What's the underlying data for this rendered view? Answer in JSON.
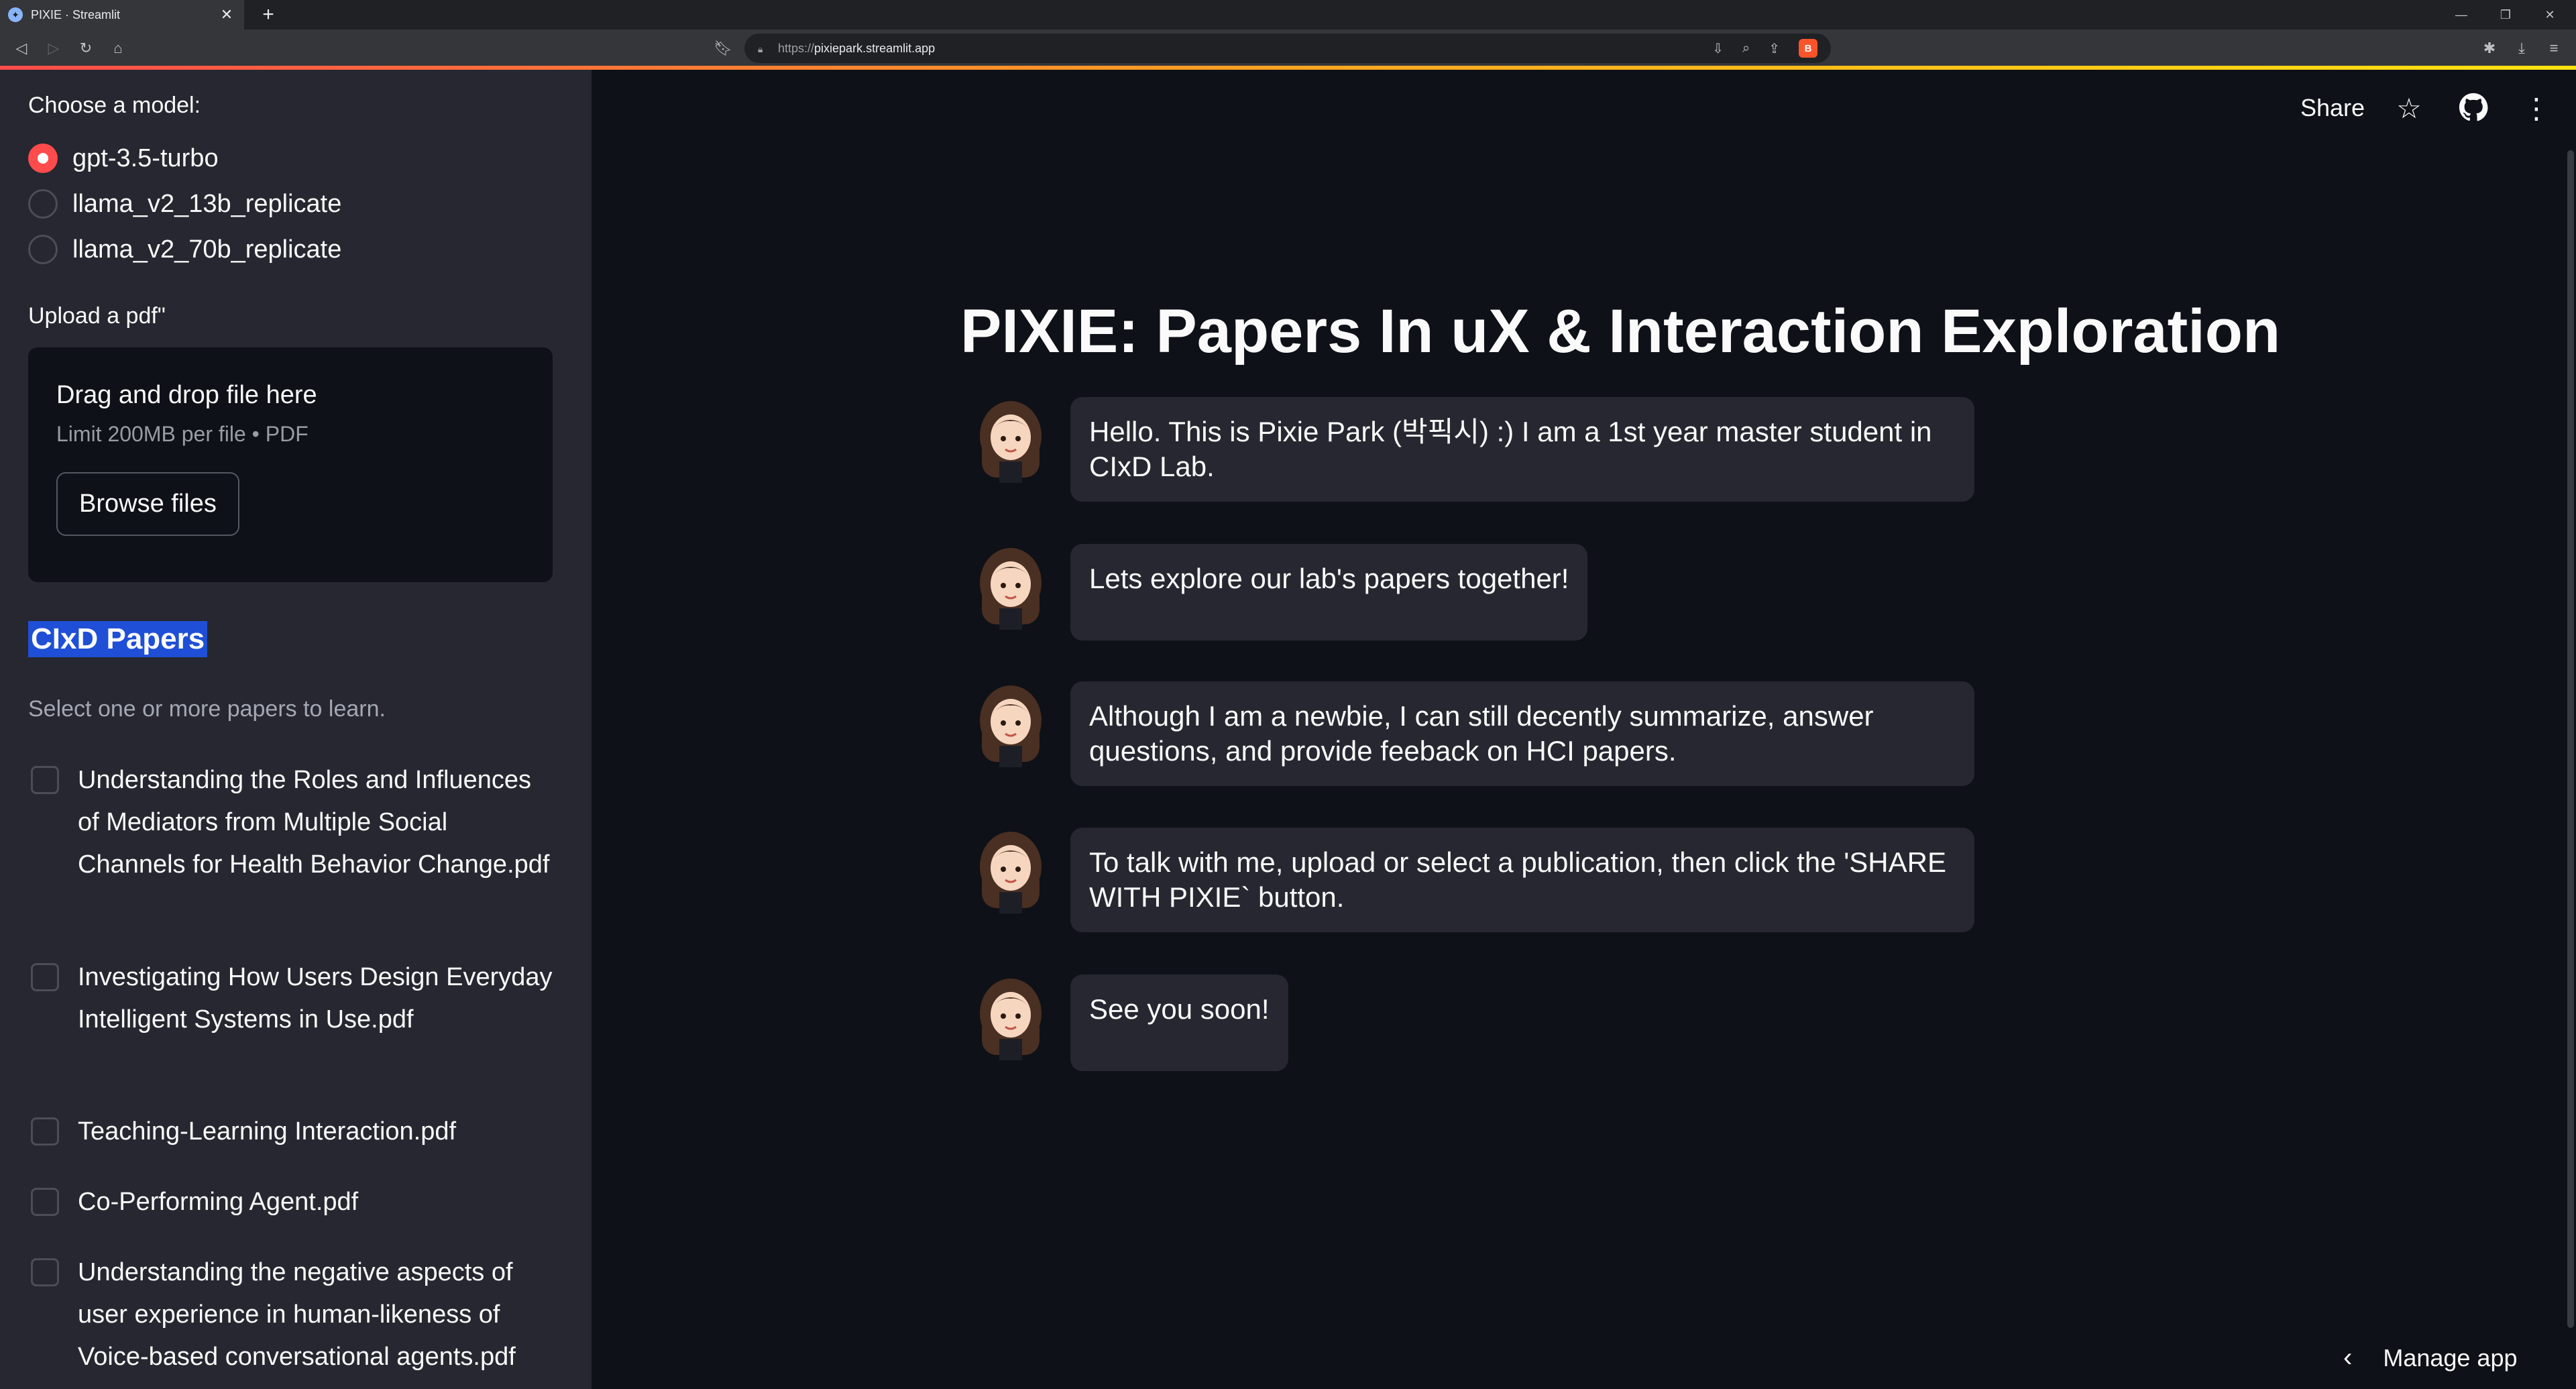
{
  "browser": {
    "tab_title": "PIXIE · Streamlit",
    "new_tab": "+",
    "close_tab": "✕",
    "url_scheme": "https://",
    "url_host": "pixiepark.streamlit.app"
  },
  "sidebar": {
    "model_label": "Choose a model:",
    "models": [
      {
        "label": "gpt-3.5-turbo",
        "selected": true
      },
      {
        "label": "llama_v2_13b_replicate",
        "selected": false
      },
      {
        "label": "llama_v2_70b_replicate",
        "selected": false
      }
    ],
    "upload_label": "Upload a pdf\"",
    "dropzone_title": "Drag and drop file here",
    "dropzone_limit": "Limit 200MB per file • PDF",
    "browse_button": "Browse files",
    "papers_title": "CIxD Papers",
    "papers_subtitle": "Select one or more papers to learn.",
    "papers": [
      "Understanding the Roles and Influences of Mediators from Multiple Social Channels for Health Behavior Change.pdf",
      "Investigating How Users Design Everyday Intelligent Systems in Use.pdf",
      "Teaching-Learning Interaction.pdf",
      "Co-Performing Agent.pdf",
      "Understanding the negative aspects of user experience in human-likeness of Voice-based conversational agents.pdf"
    ]
  },
  "header": {
    "share": "Share"
  },
  "main": {
    "title": "PIXIE: Papers In uX & Interaction Exploration",
    "messages": [
      "Hello. This is Pixie Park (박픽시) :) I am a 1st year master student in CIxD Lab.",
      "Lets explore our lab's papers together!",
      "Although I am a newbie, I can still decently summarize, answer questions, and provide feeback on HCI papers.",
      "To talk with me, upload or select a publication, then click the 'SHARE WITH PIXIE` button.",
      "See you soon!"
    ]
  },
  "footer": {
    "manage_app": "Manage app"
  },
  "colors": {
    "accent": "#ff4b4b",
    "sidebar_bg": "#262730",
    "main_bg": "#0e1117",
    "selection": "#1f4fd6"
  }
}
